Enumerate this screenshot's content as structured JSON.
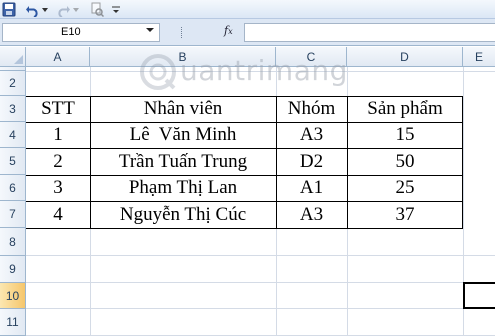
{
  "toolbar": {
    "icons": [
      "save-icon",
      "undo-icon",
      "redo-icon",
      "print-preview-icon",
      "customize-toolbar-icon"
    ]
  },
  "formula_bar": {
    "name_box_value": "E10",
    "fx_label": "f",
    "fx_sub": "x",
    "formula_value": ""
  },
  "sheet": {
    "columns": [
      "A",
      "B",
      "C",
      "D",
      "E"
    ],
    "rows": [
      "1",
      "2",
      "3",
      "4",
      "5",
      "6",
      "7",
      "8",
      "9",
      "10",
      "11"
    ],
    "selected_cell": "E10"
  },
  "table": {
    "headers": [
      "STT",
      "Nhân viên",
      "Nhóm",
      "Sản phẩm"
    ],
    "rows": [
      [
        "1",
        "Lê  Văn Minh",
        "A3",
        "15"
      ],
      [
        "2",
        "Trần Tuấn Trung",
        "D2",
        "50"
      ],
      [
        "3",
        "Phạm Thị Lan",
        "A1",
        "25"
      ],
      [
        "4",
        "Nguyễn Thị Cúc",
        "A3",
        "37"
      ]
    ]
  },
  "watermark": {
    "text": "uantrimang"
  }
}
